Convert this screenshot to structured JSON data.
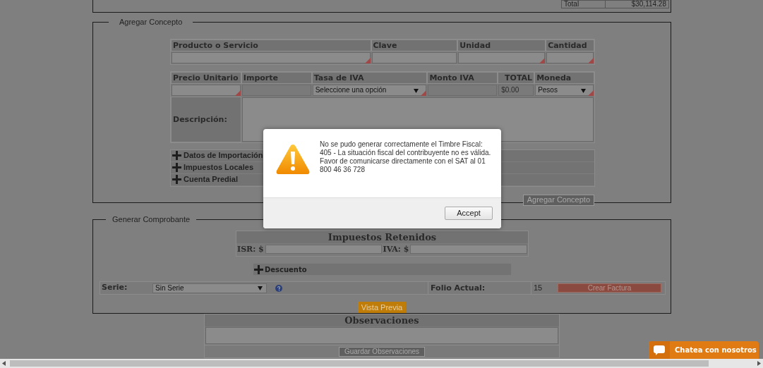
{
  "summary": {
    "label": "Total",
    "value": "$30,114.28"
  },
  "agregar_concepto": {
    "legend": "Agregar Concepto",
    "row1": [
      {
        "header": "Producto o Servicio",
        "kind": "input",
        "required": true
      },
      {
        "header": "Clave",
        "kind": "input",
        "required": false
      },
      {
        "header": "Unidad",
        "kind": "input",
        "required": true
      },
      {
        "header": "Cantidad",
        "kind": "input",
        "required": true
      }
    ],
    "row2": [
      {
        "header": "Precio Unitario",
        "kind": "input",
        "required": true
      },
      {
        "header": "Importe",
        "kind": "readonly",
        "required": false
      },
      {
        "header": "Tasa de IVA",
        "kind": "select",
        "value": "Seleccione una opción",
        "required": true
      },
      {
        "header": "Monto IVA",
        "kind": "readonly",
        "required": false
      },
      {
        "header": "TOTAL",
        "kind": "readonly",
        "value": "$0.00",
        "required": false
      },
      {
        "header": "Moneda",
        "kind": "select",
        "value": "Pesos",
        "required": true
      }
    ],
    "description_label": "Descripción:",
    "sections": [
      {
        "label": "Datos de Importación",
        "expanded": false
      },
      {
        "label": "Impuestos Locales",
        "expanded": false
      },
      {
        "label": "Cuenta Predial",
        "expanded": false
      }
    ],
    "button": "Agregar Concepto"
  },
  "generar_comprobante": {
    "legend": "Generar Comprobante",
    "retenidos": {
      "title": "Impuestos Retenidos",
      "fields": [
        {
          "label": "ISR: $"
        },
        {
          "label": "IVA: $"
        }
      ]
    },
    "descuento": {
      "label": "Descuento",
      "expanded": false
    },
    "serie_label": "Serie:",
    "serie_value": "Sin Serie",
    "folio_label": "Folio Actual:",
    "folio_value": "15",
    "create_button": "Crear Factura",
    "preview_button": "Vista Previa"
  },
  "observaciones": {
    "title": "Observaciones",
    "button": "Guardar Observaciones"
  },
  "dialog": {
    "lines": [
      "No se pudo generar correctamente el Timbre Fiscal:",
      "405 - La situación fiscal del contribuyente no es válida.",
      "Favor de comunicarse directamente con el SAT al 01",
      "800 46 36 728"
    ],
    "button": "Accept"
  },
  "chat": {
    "label": "Chatea con nosotros"
  }
}
